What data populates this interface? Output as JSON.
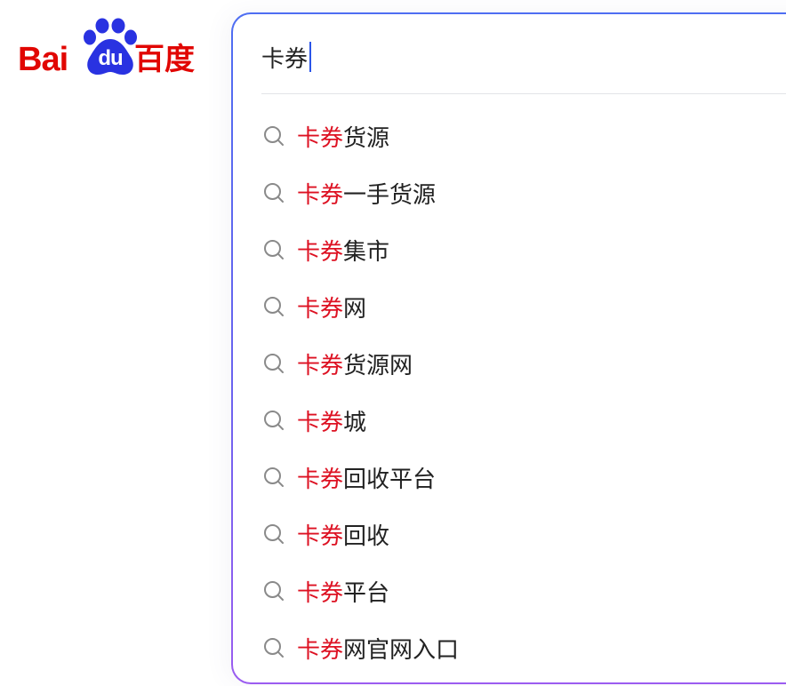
{
  "logo": {
    "bai": "Bai",
    "du": "du",
    "chinese": "百度"
  },
  "search": {
    "value": "卡券"
  },
  "suggestions": [
    {
      "highlight": "卡券",
      "rest": "货源"
    },
    {
      "highlight": "卡券",
      "rest": "一手货源"
    },
    {
      "highlight": "卡券",
      "rest": "集市"
    },
    {
      "highlight": "卡券",
      "rest": "网"
    },
    {
      "highlight": "卡券",
      "rest": "货源网"
    },
    {
      "highlight": "卡券",
      "rest": "城"
    },
    {
      "highlight": "卡券",
      "rest": "回收平台"
    },
    {
      "highlight": "卡券",
      "rest": "回收"
    },
    {
      "highlight": "卡券",
      "rest": "平台"
    },
    {
      "highlight": "卡券",
      "rest": "网官网入口"
    }
  ],
  "icons": {
    "suggestion": "search-icon",
    "logo_mark": "paw-icon"
  },
  "colors": {
    "brand_red": "#e10602",
    "brand_blue": "#2932e1",
    "highlight": "#dd1122",
    "border_gradient_top": "#4e6ef2",
    "border_gradient_bottom": "#9b5cf0",
    "caret": "#2b55e8"
  }
}
